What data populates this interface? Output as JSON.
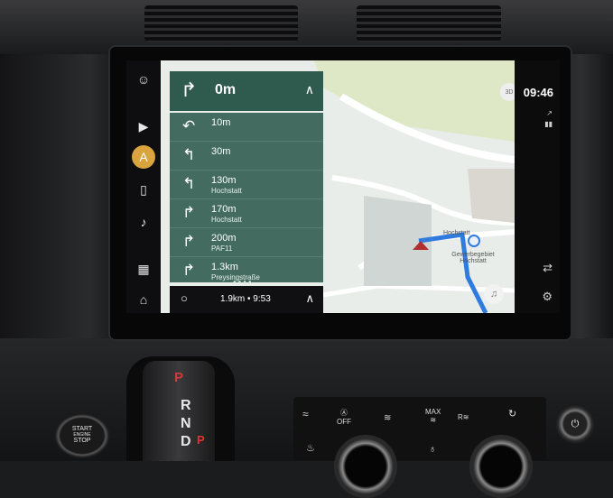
{
  "colors": {
    "nav_panel": "#2f5b4f",
    "active_rail": "#d9a33e",
    "route": "#2f7be0"
  },
  "rail": {
    "items": [
      {
        "name": "profile-icon",
        "glyph": "☺"
      },
      {
        "name": "media-play-icon",
        "glyph": "▶"
      },
      {
        "name": "navigation-icon",
        "glyph": "A"
      },
      {
        "name": "phone-icon",
        "glyph": "▯"
      },
      {
        "name": "music-icon",
        "glyph": "♪"
      },
      {
        "name": "apps-grid-icon",
        "glyph": "▦"
      },
      {
        "name": "home-icon",
        "glyph": "⌂"
      }
    ]
  },
  "nav": {
    "current_distance": "0m",
    "current_arrow": "↱",
    "turns": [
      {
        "icon": "↶",
        "distance": "10m",
        "street": ""
      },
      {
        "icon": "↰",
        "distance": "30m",
        "street": ""
      },
      {
        "icon": "↰",
        "distance": "130m",
        "street": "Hochstatt"
      },
      {
        "icon": "↱",
        "distance": "170m",
        "street": "Hochstatt"
      },
      {
        "icon": "↱",
        "distance": "200m",
        "street": "PAF11"
      },
      {
        "icon": "↱",
        "distance": "1.3km",
        "street": "Preysingstraße"
      }
    ],
    "footer_eta": "1.9km • 9:53"
  },
  "map": {
    "view_button": "3D",
    "label_hochstatt": "Hochstatt",
    "label_gewerbe": "Gewerbegebiet Hochstatt"
  },
  "status": {
    "time": "09:46"
  },
  "controls": {
    "start_stop_line1": "START",
    "start_stop_line2": "ENGINE",
    "start_stop_line3": "STOP",
    "gear_p": "P",
    "gear_letters": "R\nN\nD",
    "auto_off": "OFF",
    "max_label": "MAX",
    "rear_label": "R"
  }
}
